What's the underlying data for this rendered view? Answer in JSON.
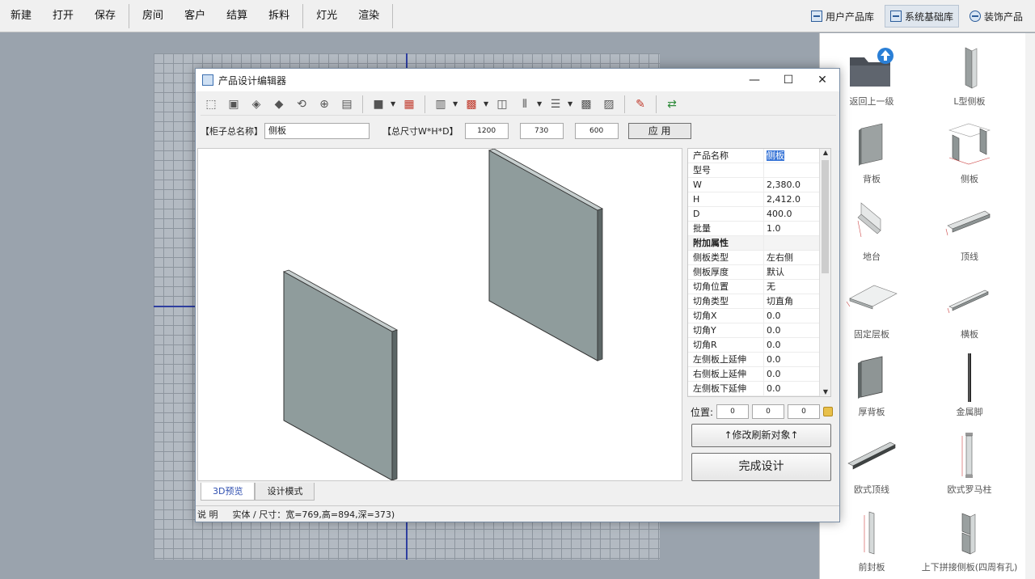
{
  "menubar": {
    "items": [
      "新建",
      "打开",
      "保存",
      "房间",
      "客户",
      "结算",
      "拆料",
      "灯光",
      "渲染"
    ],
    "libraries": [
      {
        "label": "用户产品库",
        "icon": "user-library-icon"
      },
      {
        "label": "系统基础库",
        "icon": "system-library-icon"
      },
      {
        "label": "装饰产品",
        "icon": "decor-search-icon"
      }
    ]
  },
  "library": {
    "items": [
      {
        "label": "返回上一级",
        "icon": "folder-up-icon"
      },
      {
        "label": "L型侧板",
        "icon": "l-side-panel-icon"
      },
      {
        "label": "背板",
        "icon": "back-panel-icon"
      },
      {
        "label": "侧板",
        "icon": "side-panel-icon"
      },
      {
        "label": "地台",
        "icon": "plinth-icon"
      },
      {
        "label": "顶线",
        "icon": "top-molding-icon"
      },
      {
        "label": "固定层板",
        "icon": "fixed-shelf-icon"
      },
      {
        "label": "横板",
        "icon": "horizontal-panel-icon"
      },
      {
        "label": "厚背板",
        "icon": "thick-back-panel-icon"
      },
      {
        "label": "金属脚",
        "icon": "metal-leg-icon"
      },
      {
        "label": "欧式顶线",
        "icon": "euro-top-molding-icon"
      },
      {
        "label": "欧式罗马柱",
        "icon": "roman-column-icon"
      },
      {
        "label": "前封板",
        "icon": "front-cover-icon"
      },
      {
        "label": "上下拼接侧板(四周有孔)",
        "icon": "spliced-side-panel-icon"
      }
    ]
  },
  "dialog": {
    "title": "产品设计编辑器",
    "window_controls": {
      "minimize": "—",
      "maximize": "☐",
      "close": "✕"
    },
    "name_label": "【柜子总名称】",
    "name_value": "侧板",
    "size_label": "【总尺寸W*H*D】",
    "size_w": "1200",
    "size_h": "730",
    "size_d": "600",
    "apply_label": "应 用",
    "properties": [
      {
        "key": "产品名称",
        "value": "侧板",
        "selected": true
      },
      {
        "key": "型号",
        "value": ""
      },
      {
        "key": "W",
        "value": "2,380.0"
      },
      {
        "key": "H",
        "value": "2,412.0"
      },
      {
        "key": "D",
        "value": "400.0"
      },
      {
        "key": "批量",
        "value": "1.0"
      },
      {
        "key": "附加属性",
        "value": "",
        "section": true
      },
      {
        "key": "侧板类型",
        "value": "左右侧"
      },
      {
        "key": "侧板厚度",
        "value": "默认"
      },
      {
        "key": "切角位置",
        "value": "无"
      },
      {
        "key": "切角类型",
        "value": "切直角"
      },
      {
        "key": "切角X",
        "value": "0.0"
      },
      {
        "key": "切角Y",
        "value": "0.0"
      },
      {
        "key": "切角R",
        "value": "0.0"
      },
      {
        "key": "左侧板上延伸",
        "value": "0.0"
      },
      {
        "key": "右侧板上延伸",
        "value": "0.0"
      },
      {
        "key": "左侧板下延伸",
        "value": "0.0"
      }
    ],
    "position_label": "位置:",
    "position": [
      "0",
      "0",
      "0"
    ],
    "refresh_label": "↑修改刷新对象↑",
    "finish_label": "完成设计",
    "tabs": [
      "3D预览",
      "设计模式"
    ],
    "status_label": "说 明",
    "status_text": "实体 / 尺寸：宽=769,高=894,深=373)",
    "colors": {
      "panel_face": "#8f9c9c",
      "panel_edge": "#c6cece",
      "panel_dark": "#5c6666",
      "accent": "#3875d7"
    }
  }
}
